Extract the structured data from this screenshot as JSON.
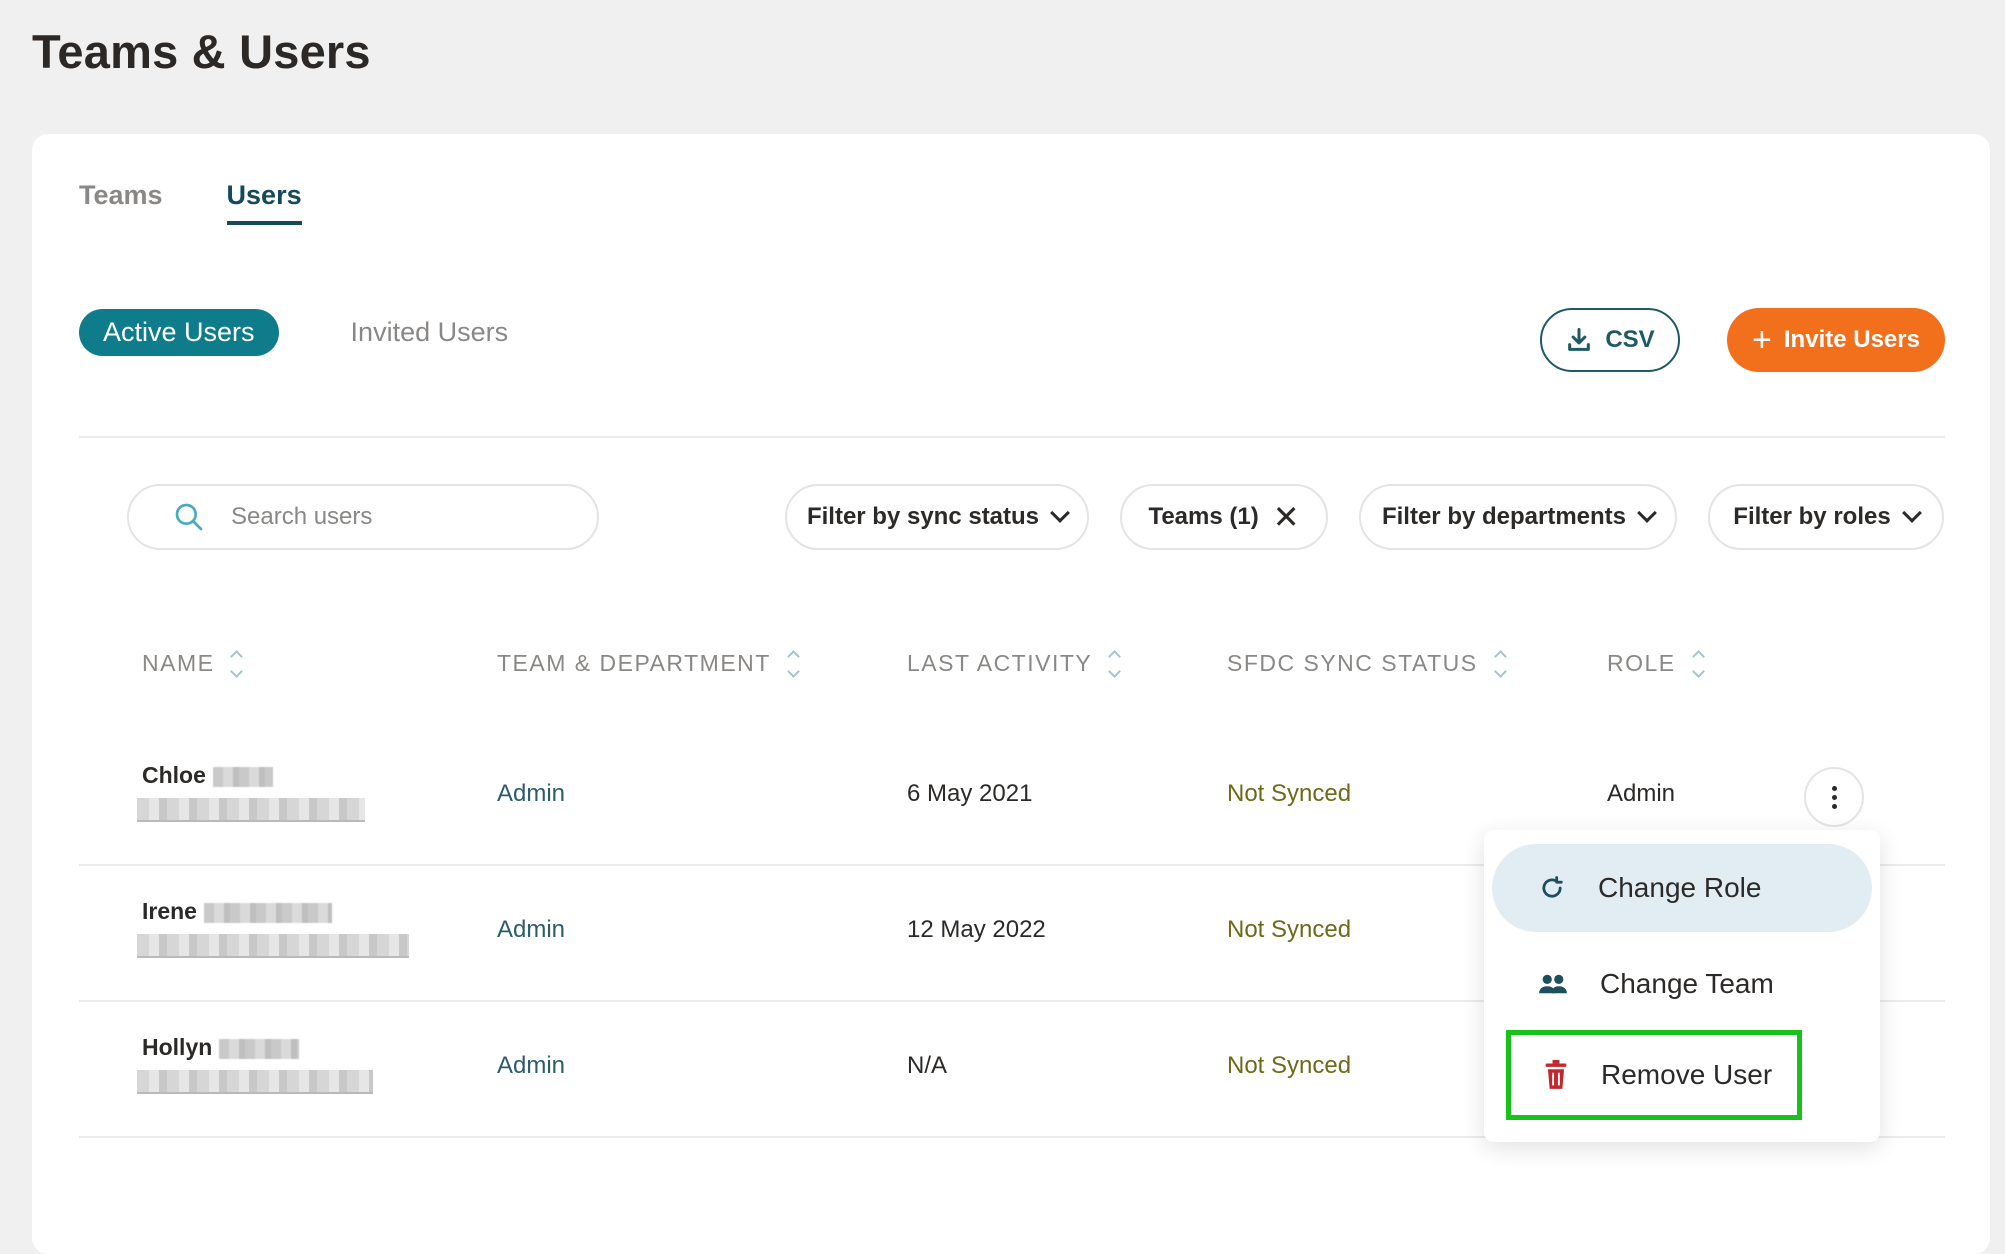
{
  "page": {
    "title": "Teams & Users"
  },
  "tabs": [
    {
      "label": "Teams",
      "active": false
    },
    {
      "label": "Users",
      "active": true
    }
  ],
  "segment": {
    "active": "Active Users",
    "inactive": "Invited Users"
  },
  "actions": {
    "csv_label": "CSV",
    "invite_label": "Invite Users",
    "invite_color": "#f26f1c"
  },
  "search": {
    "placeholder": "Search users",
    "value": ""
  },
  "filters": {
    "sync": "Filter by sync status",
    "teams": "Teams (1)",
    "departments": "Filter by departments",
    "roles": "Filter by roles"
  },
  "table": {
    "columns": [
      "NAME",
      "TEAM & DEPARTMENT",
      "LAST ACTIVITY",
      "SFDC SYNC STATUS",
      "ROLE"
    ],
    "rows": [
      {
        "first_name": "Chloe",
        "team": "Admin",
        "last_activity": "6 May 2021",
        "sync": "Not Synced",
        "role": "Admin"
      },
      {
        "first_name": "Irene",
        "team": "Admin",
        "last_activity": "12 May 2022",
        "sync": "Not Synced",
        "role": ""
      },
      {
        "first_name": "Hollyn",
        "team": "Admin",
        "last_activity": "N/A",
        "sync": "Not Synced",
        "role": ""
      }
    ]
  },
  "row_menu": {
    "items": [
      {
        "label": "Change Role",
        "icon": "refresh-icon"
      },
      {
        "label": "Change Team",
        "icon": "users-icon"
      },
      {
        "label": "Remove User",
        "icon": "trash-icon",
        "color": "#c0282d"
      }
    ],
    "highlight_color": "#18c21b"
  },
  "colors": {
    "primary": "#0f7c8b",
    "dark_teal": "#164a5a",
    "sync_text": "#6d6a1a"
  }
}
